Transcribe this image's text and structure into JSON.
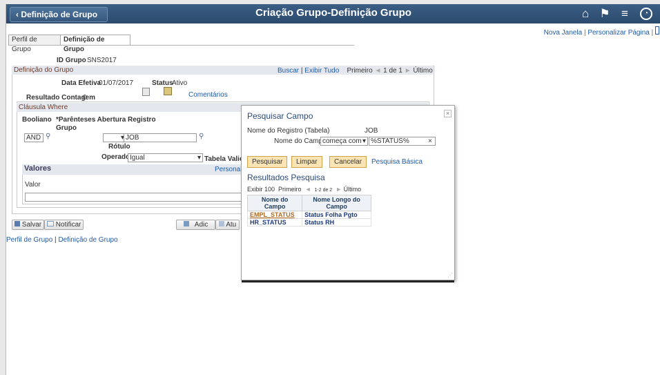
{
  "banner": {
    "back_label": "Definição de Grupo",
    "title": "Criação Grupo-Definição Grupo"
  },
  "top_links": {
    "new_window": "Nova Janela",
    "sep": "|",
    "personalize_page": "Personalizar Página",
    "sep2": "|"
  },
  "tabs": [
    {
      "label": "Perfil de Grupo"
    },
    {
      "label": "Definição de Grupo"
    }
  ],
  "group_id": {
    "label": "ID Grupo",
    "value": "SNS2017"
  },
  "group_def": {
    "title": "Definição do Grupo",
    "find": "Buscar",
    "view_all": "Exibir Tudo",
    "first": "Primeiro",
    "page": "1 de 1",
    "last": "Último",
    "eff_date_label": "Data Efetiva",
    "eff_date": "01/07/2017",
    "status_label": "Status",
    "status": "Ativo",
    "comments": "Comentários",
    "count_label": "Resultado Contagem",
    "count": "0"
  },
  "where": {
    "title": "Cláusula Where",
    "col_bool": "Booliano",
    "col_paren": "*Parênteses Abertura",
    "col_group": "Grupo",
    "col_record": "Registro",
    "bool_value": "AND",
    "record_value": "JOB",
    "label_label": "Rótulo",
    "operator_label": "Operador",
    "operator_value": "Igual",
    "valid_table": "Tabela Valid"
  },
  "values": {
    "title": "Valores",
    "personalize": "Personaliz",
    "col_value": "Valor"
  },
  "actions": {
    "save": "Salvar",
    "notify": "Notificar",
    "add": "Adic",
    "update": "Atu"
  },
  "footer_links": {
    "profile": "Perfil de Grupo",
    "sep": "|",
    "definition": "Definição de Grupo"
  },
  "modal": {
    "title": "Pesquisar Campo",
    "record_label": "Nome do Registro (Tabela)",
    "record_value": "JOB",
    "field_label": "Nome do Campo",
    "operator": "começa com",
    "field_value": "%STATUS%",
    "search": "Pesquisar",
    "clear": "Limpar",
    "cancel": "Cancelar",
    "basic": "Pesquisa Básica",
    "results_title": "Resultados Pesquisa",
    "show": "Exibir 100",
    "first": "Primeiro",
    "range": "1-2 de 2",
    "last": "Último",
    "col_name": "Nome do Campo",
    "col_long": "Nome Longo do Campo",
    "rows": [
      {
        "name": "EMPL_STATUS",
        "long": "Status Folha Pgto"
      },
      {
        "name": "HR_STATUS",
        "long": "Status RH"
      }
    ]
  }
}
